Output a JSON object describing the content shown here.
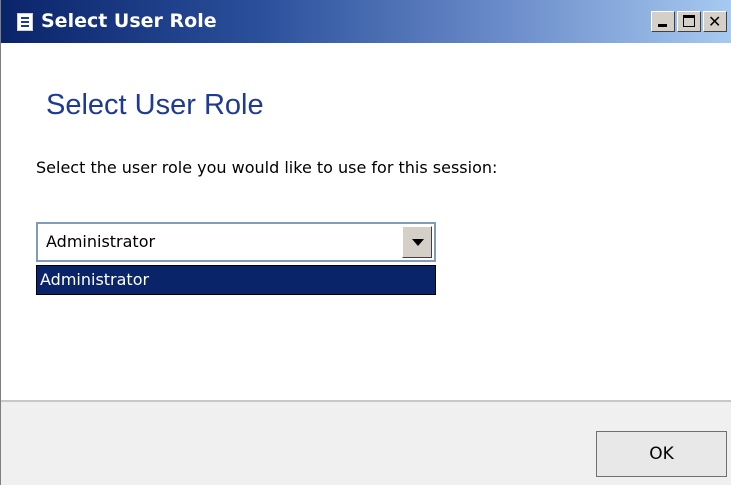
{
  "window": {
    "title": "Select User Role",
    "controls": {
      "minimize_icon": "minimize-icon",
      "maximize_icon": "maximize-icon",
      "close_icon": "close-icon"
    },
    "icon": "app-window-icon",
    "title_gradient": [
      "#0a246a",
      "#a6caf0"
    ]
  },
  "main": {
    "heading": "Select User Role",
    "instruction": "Select the user role you would like to use for this session:",
    "role_select": {
      "selected_value": "Administrator",
      "options": [
        "Administrator"
      ],
      "highlighted_option_color": "#0a246a"
    }
  },
  "footer": {
    "ok_label": "OK"
  },
  "colors": {
    "heading": "#1f3a93",
    "footer_bg": "#f0f0f0"
  }
}
